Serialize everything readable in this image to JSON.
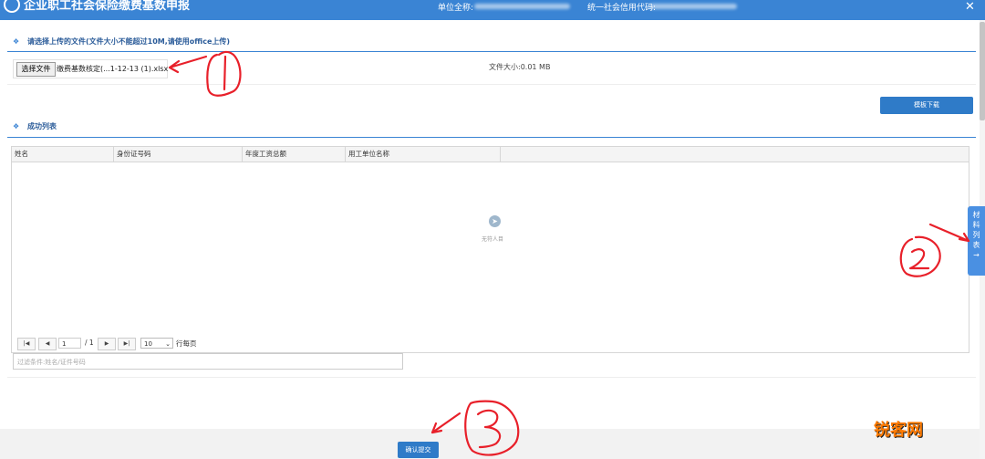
{
  "header": {
    "title": "企业职工社会保险缴费基数申报",
    "unit_label": "单位全称:",
    "code_label": "统一社会信用代码:",
    "close": "✕"
  },
  "upload": {
    "section_title": "请选择上传的文件(文件大小不能超过10M,请使用office上传)",
    "choose_button": "选择文件",
    "file_name": "缴费基数核定(...1-12-13 (1).xlsx",
    "file_size": "文件大小:0.01 MB",
    "template_button": "模板下载"
  },
  "success": {
    "section_title": "成功列表",
    "columns": [
      "姓名",
      "身份证号码",
      "年度工资总额",
      "用工单位名称"
    ],
    "empty_text": "无符人目"
  },
  "pager": {
    "first": "|◀",
    "prev": "◀",
    "page": "1",
    "total": "/ 1",
    "next": "▶",
    "last": "▶|",
    "page_size": "10",
    "per_page": "行每页"
  },
  "filter": {
    "placeholder": "过滤条件:姓名/证件号码"
  },
  "submit_button": "确认提交",
  "side_tab": {
    "chars": [
      "材",
      "料",
      "列",
      "表"
    ],
    "arrow": "→"
  },
  "watermark": "锐客网",
  "colors": {
    "header_blue": "#3a84d4",
    "button_blue": "#2f7bc8",
    "annotation_red": "#e8202a",
    "watermark_orange": "#ff7a00"
  }
}
